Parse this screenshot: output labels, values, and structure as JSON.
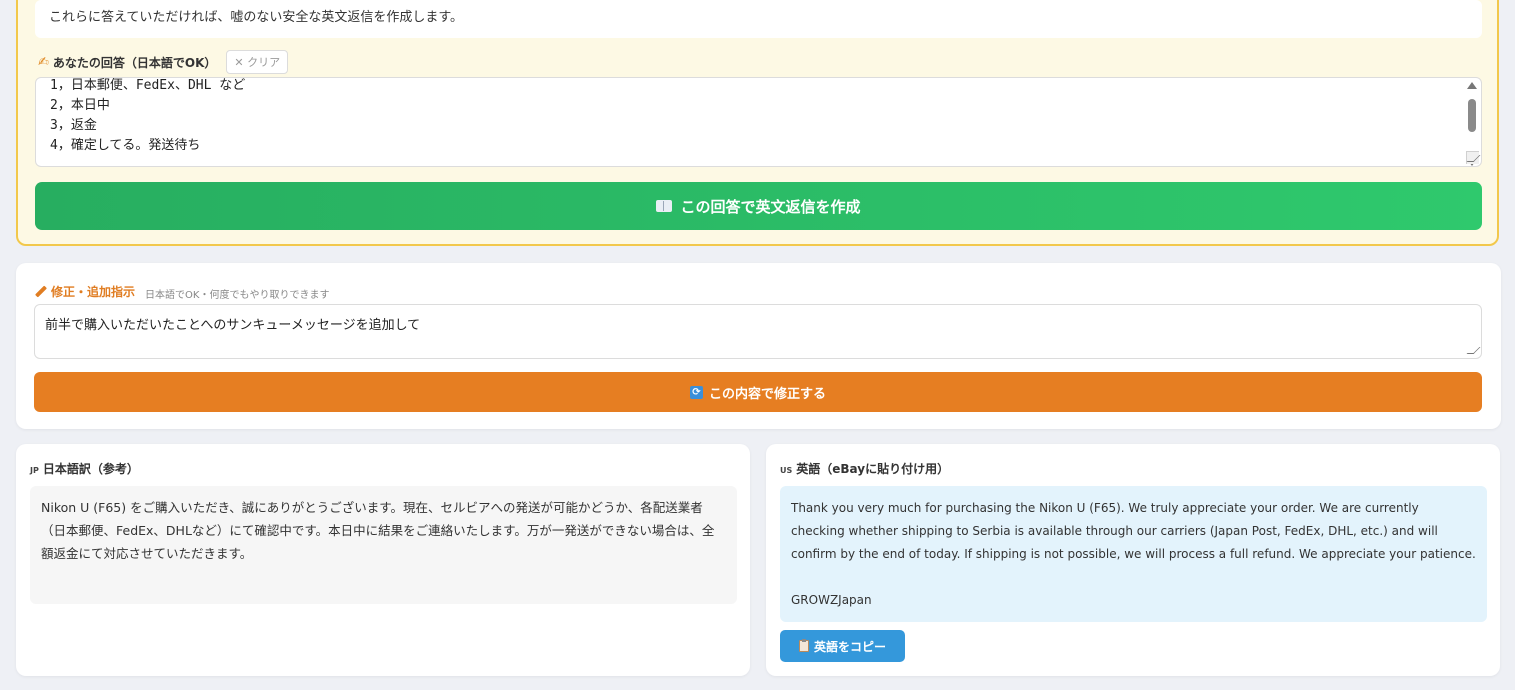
{
  "questions_card": {
    "note": "これらに答えていただければ、嘘のない安全な英文返信を作成します。",
    "answer_label": "あなたの回答（日本語でOK）",
    "clear_label": "✕ クリア",
    "answer_lines": [
      "1，日本郵便、FedEx、DHL など",
      "2，本日中",
      "3，返金",
      "4，確定してる。発送待ち"
    ],
    "create_button_label": "この回答で英文返信を作成"
  },
  "revision": {
    "label": "修正・追加指示",
    "hint": "日本語でOK・何度でもやり取りできます",
    "input_value": "前半で購入いただいたことへのサンキューメッセージを追加して",
    "submit_label": "この内容で修正する"
  },
  "japanese_result": {
    "flag": "JP",
    "title": "日本語訳（参考）",
    "body": "Nikon U (F65) をご購入いただき、誠にありがとうございます。現在、セルビアへの発送が可能かどうか、各配送業者（日本郵便、FedEx、DHLなど）にて確認中です。本日中に結果をご連絡いたします。万が一発送ができない場合は、全額返金にて対応させていただきます。"
  },
  "english_result": {
    "flag": "US",
    "title": "英語（eBayに貼り付け用）",
    "body": "Thank you very much for purchasing the Nikon U (F65). We truly appreciate your order. We are currently checking whether shipping to Serbia is available through our carriers (Japan Post, FedEx, DHL, etc.) and will confirm by the end of today. If shipping is not possible, we will process a full refund. We appreciate your patience.",
    "signature": "GROWZJapan",
    "copy_label": "英語をコピー"
  },
  "colors": {
    "page_bg": "#eef0f5",
    "questions_bg": "#fdf9e4",
    "questions_border": "#f2c84b",
    "create_button": "#27ae60",
    "revision_accent": "#e07d22",
    "fix_button": "#e67e22",
    "english_bg": "#e3f3fc",
    "copy_button": "#3498db"
  },
  "icons": {
    "answer_label": "writing-hand-icon",
    "create_button": "book-icon",
    "revision_label": "pencil-icon",
    "fix_button": "refresh-icon",
    "copy_button": "clipboard-icon"
  }
}
